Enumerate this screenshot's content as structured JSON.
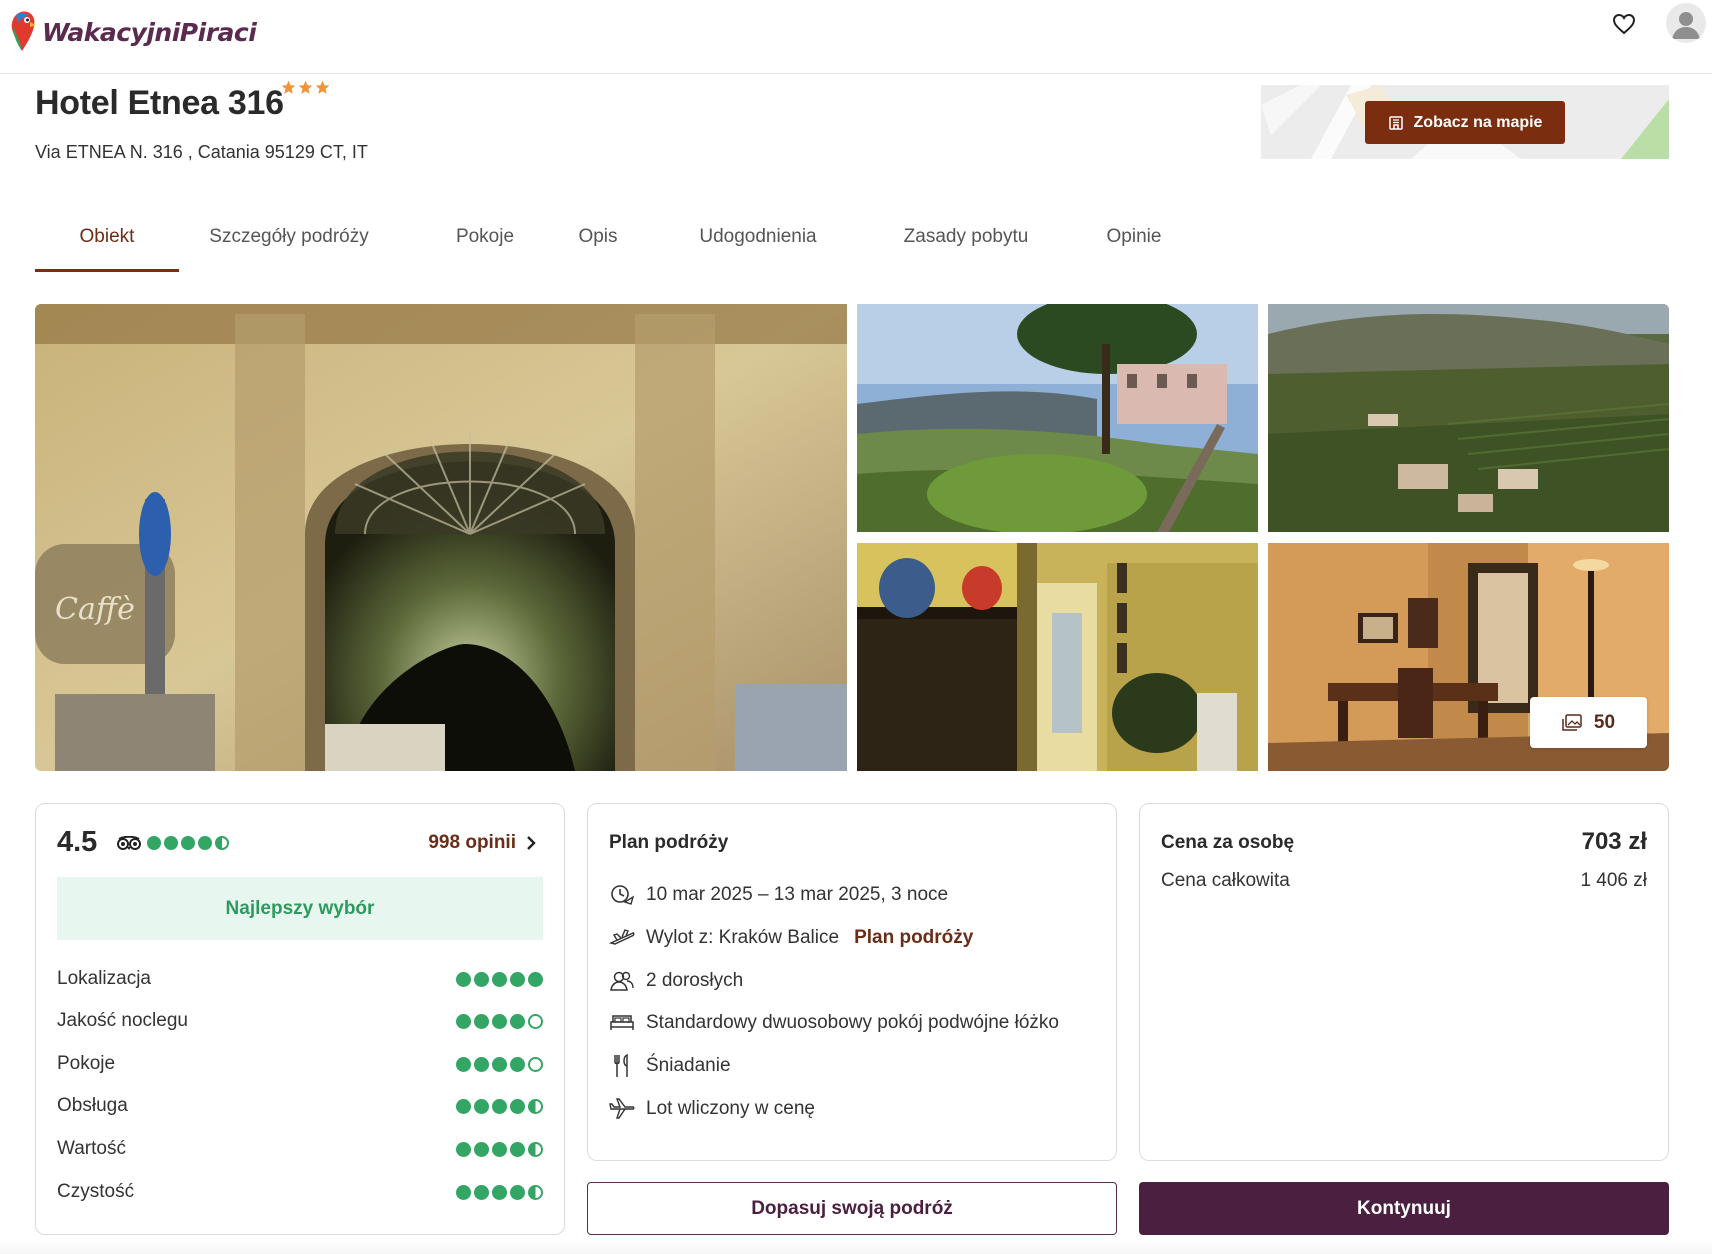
{
  "header": {
    "logo_text": "WakacyjniPiraci"
  },
  "hotel": {
    "name": "Hotel Etnea 316",
    "stars": 3,
    "address": "Via ETNEA N. 316 , Catania 95129 CT, IT",
    "map_button": "Zobacz na mapie"
  },
  "tabs": [
    {
      "label": "Obiekt",
      "active": true
    },
    {
      "label": "Szczegóły podróży",
      "active": false
    },
    {
      "label": "Pokoje",
      "active": false
    },
    {
      "label": "Opis",
      "active": false
    },
    {
      "label": "Udogodnienia",
      "active": false
    },
    {
      "label": "Zasady pobytu",
      "active": false
    },
    {
      "label": "Opinie",
      "active": false
    }
  ],
  "gallery": {
    "photo_count": "50"
  },
  "rating": {
    "score": "4.5",
    "tripadvisor_bubbles": 4.5,
    "reviews_link": "998 opinii",
    "badge": "Najlepszy wybór",
    "categories": [
      {
        "label": "Lokalizacja",
        "value": 5
      },
      {
        "label": "Jakość noclegu",
        "value": 4
      },
      {
        "label": "Pokoje",
        "value": 4
      },
      {
        "label": "Obsługa",
        "value": 4.5
      },
      {
        "label": "Wartość",
        "value": 4.5
      },
      {
        "label": "Czystość",
        "value": 4.5
      }
    ]
  },
  "plan": {
    "title": "Plan podróży",
    "dates": "10 mar 2025 – 13 mar 2025, 3 noce",
    "departure": "Wylot z: Kraków Balice",
    "departure_link": "Plan podróży",
    "guests": "2 dorosłych",
    "room": "Standardowy dwuosobowy pokój podwójne łóżko",
    "board": "Śniadanie",
    "flight": "Lot wliczony w cenę"
  },
  "price": {
    "per_person_label": "Cena za osobę",
    "per_person_value": "703 zł",
    "total_label": "Cena całkowita",
    "total_value": "1 406 zł"
  },
  "actions": {
    "adjust_label": "Dopasuj swoją podróż",
    "continue_label": "Kontynuuj"
  },
  "colors": {
    "brand_primary": "#4a1f3f",
    "accent_brown": "#7b2d10",
    "rating_green": "#33a565",
    "star_orange": "#f39237"
  }
}
